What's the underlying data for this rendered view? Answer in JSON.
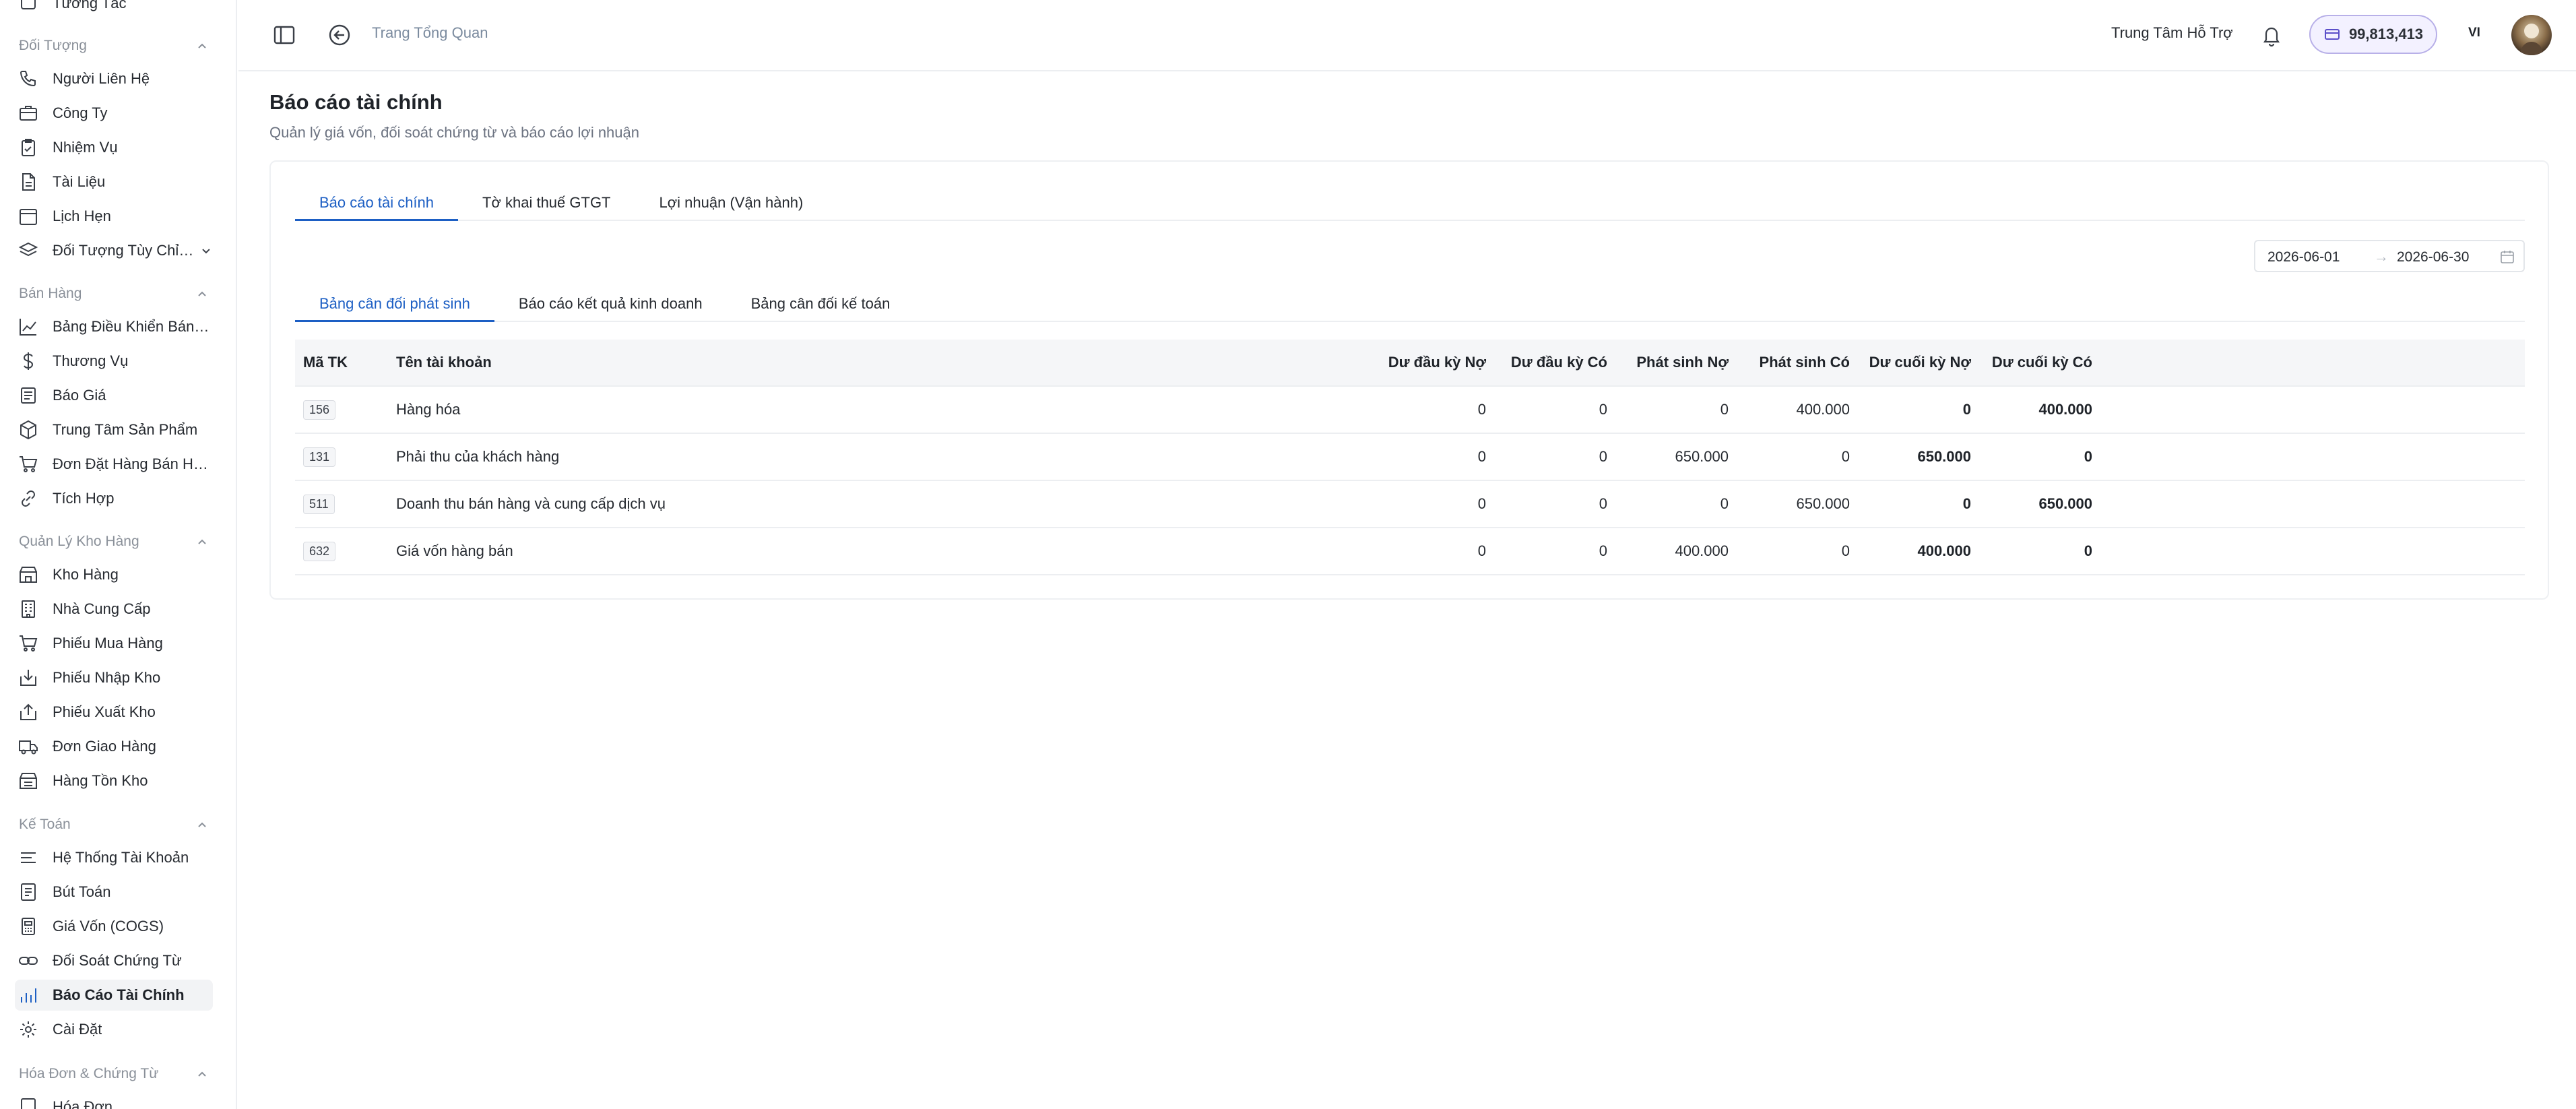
{
  "sidebar": {
    "groups": [
      {
        "label": "Đối Tượng",
        "items": [
          {
            "label": "Người Liên Hệ",
            "icon": "phone-icon"
          },
          {
            "label": "Công Ty",
            "icon": "building-icon"
          },
          {
            "label": "Nhiệm Vụ",
            "icon": "clipboard-icon"
          },
          {
            "label": "Tài Liệu",
            "icon": "file-icon"
          },
          {
            "label": "Lịch Hẹn",
            "icon": "calendar-icon"
          },
          {
            "label": "Đối Tượng Tùy Chỉnh",
            "icon": "layers-icon"
          }
        ]
      },
      {
        "label": "Bán Hàng",
        "items": [
          {
            "label": "Bảng Điều Khiển Bán Hàng",
            "icon": "chart-line-icon"
          },
          {
            "label": "Thương Vụ",
            "icon": "dollar-icon"
          },
          {
            "label": "Báo Giá",
            "icon": "receipt-icon"
          },
          {
            "label": "Trung Tâm Sản Phẩm",
            "icon": "box-icon"
          },
          {
            "label": "Đơn Đặt Hàng Bán Hàng",
            "icon": "cart-icon"
          },
          {
            "label": "Tích Hợp",
            "icon": "link-icon"
          }
        ]
      },
      {
        "label": "Quản Lý Kho Hàng",
        "items": [
          {
            "label": "Kho Hàng",
            "icon": "store-icon"
          },
          {
            "label": "Nhà Cung Cấp",
            "icon": "supplier-icon"
          },
          {
            "label": "Phiếu Mua Hàng",
            "icon": "cart-icon"
          },
          {
            "label": "Phiếu Nhập Kho",
            "icon": "import-icon"
          },
          {
            "label": "Phiếu Xuất Kho",
            "icon": "export-icon"
          },
          {
            "label": "Đơn Giao Hàng",
            "icon": "truck-icon"
          },
          {
            "label": "Hàng Tồn Kho",
            "icon": "warehouse-icon"
          }
        ]
      },
      {
        "label": "Kế Toán",
        "items": [
          {
            "label": "Hệ Thống Tài Khoản",
            "icon": "list-icon"
          },
          {
            "label": "Bút Toán",
            "icon": "journal-icon"
          },
          {
            "label": "Giá Vốn (COGS)",
            "icon": "calculator-icon"
          },
          {
            "label": "Đối Soát Chứng Từ",
            "icon": "link-icon"
          },
          {
            "label": "Báo Cáo Tài Chính",
            "icon": "bar-chart-icon"
          },
          {
            "label": "Cài Đặt",
            "icon": "gear-icon"
          }
        ]
      },
      {
        "label": "Hóa Đơn & Chứng Từ",
        "items": [
          {
            "label": "Hóa Đơn",
            "icon": "invoice-icon"
          }
        ]
      }
    ],
    "top_partial_label": "Tương Tác"
  },
  "topbar": {
    "breadcrumb": "Trang Tổng Quan",
    "support": "Trung Tâm Hỗ Trợ",
    "credit": "99,813,413",
    "lang": "VI"
  },
  "page": {
    "title": "Báo cáo tài chính",
    "subtitle": "Quản lý giá vốn, đối soát chứng từ và báo cáo lợi nhuận"
  },
  "tabs": [
    "Báo cáo tài chính",
    "Tờ khai thuế GTGT",
    "Lợi nhuận (Vận hành)"
  ],
  "subtabs": [
    "Bảng cân đối phát sinh",
    "Báo cáo kết quả kinh doanh",
    "Bảng cân đối kế toán"
  ],
  "daterange": {
    "from": "2026-06-01",
    "arrow": "→",
    "to": "2026-06-30"
  },
  "table": {
    "headers": [
      "Mã TK",
      "Tên tài khoản",
      "Dư đầu kỳ Nợ",
      "Dư đầu kỳ Có",
      "Phát sinh Nợ",
      "Phát sinh Có",
      "Dư cuối kỳ Nợ",
      "Dư cuối kỳ Có"
    ],
    "rows": [
      [
        "156",
        "Hàng hóa",
        "0",
        "0",
        "0",
        "400.000",
        "0",
        "400.000"
      ],
      [
        "131",
        "Phải thu của khách hàng",
        "0",
        "0",
        "650.000",
        "0",
        "650.000",
        "0"
      ],
      [
        "511",
        "Doanh thu bán hàng và cung cấp dịch vụ",
        "0",
        "0",
        "0",
        "650.000",
        "0",
        "650.000"
      ],
      [
        "632",
        "Giá vốn hàng bán",
        "0",
        "0",
        "400.000",
        "0",
        "400.000",
        "0"
      ]
    ]
  },
  "colors": {
    "accent": "#1d5fc4",
    "credit_border": "#b8b0e8",
    "credit_bg": "#f3f1ff"
  }
}
